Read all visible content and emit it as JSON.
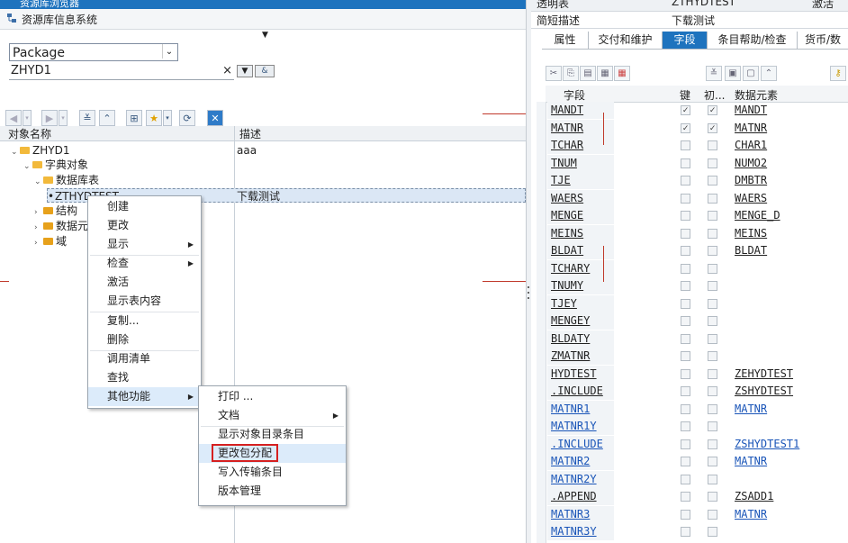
{
  "left": {
    "window_title": "资源库浏览器",
    "system_title": "资源库信息系统",
    "object_type": "Package",
    "object_name": "ZHYD1",
    "columns": {
      "name": "对象名称",
      "desc": "描述"
    },
    "tree": [
      {
        "label": "ZHYD1",
        "desc": "aaa"
      },
      {
        "label": "字典对象",
        "desc": ""
      },
      {
        "label": "数据库表",
        "desc": ""
      },
      {
        "label": "ZTHYDTEST",
        "desc": "下载测试"
      },
      {
        "label": "结构",
        "desc": ""
      },
      {
        "label": "数据元",
        "desc": ""
      },
      {
        "label": "域",
        "desc": ""
      }
    ],
    "context_menu": [
      "创建",
      "更改",
      "显示",
      "检查",
      "激活",
      "显示表内容",
      "复制...",
      "删除",
      "调用清单",
      "查找",
      "其他功能"
    ],
    "submenu": [
      "打印 ...",
      "文档",
      "显示对象目录条目",
      "更改包分配",
      "写入传输条目",
      "版本管理"
    ]
  },
  "right": {
    "header": [
      {
        "label": "透明表",
        "value": "ZTHYDTEST",
        "status": "激活"
      },
      {
        "label": "简短描述",
        "value": "下载测试",
        "status": ""
      }
    ],
    "tabs": [
      "属性",
      "交付和维护",
      "字段",
      "条目帮助/检查",
      "货币/数"
    ],
    "active_tab": "字段",
    "grid_headers": {
      "field": "字段",
      "key": "键",
      "init": "初...",
      "element": "数据元素"
    },
    "rows": [
      {
        "field": "MANDT",
        "key": true,
        "init": true,
        "elem": "MANDT",
        "blue": false
      },
      {
        "field": "MATNR",
        "key": true,
        "init": true,
        "elem": "MATNR",
        "blue": false
      },
      {
        "field": "TCHAR",
        "key": false,
        "init": false,
        "elem": "CHAR1",
        "blue": false
      },
      {
        "field": "TNUM",
        "key": false,
        "init": false,
        "elem": "NUMO2",
        "blue": false
      },
      {
        "field": "TJE",
        "key": false,
        "init": false,
        "elem": "DMBTR",
        "blue": false
      },
      {
        "field": "WAERS",
        "key": false,
        "init": false,
        "elem": "WAERS",
        "blue": false
      },
      {
        "field": "MENGE",
        "key": false,
        "init": false,
        "elem": "MENGE_D",
        "blue": false
      },
      {
        "field": "MEINS",
        "key": false,
        "init": false,
        "elem": "MEINS",
        "blue": false
      },
      {
        "field": "BLDAT",
        "key": false,
        "init": false,
        "elem": "BLDAT",
        "blue": false
      },
      {
        "field": "TCHARY",
        "key": false,
        "init": false,
        "elem": "",
        "blue": false
      },
      {
        "field": "TNUMY",
        "key": false,
        "init": false,
        "elem": "",
        "blue": false
      },
      {
        "field": "TJEY",
        "key": false,
        "init": false,
        "elem": "",
        "blue": false
      },
      {
        "field": "MENGEY",
        "key": false,
        "init": false,
        "elem": "",
        "blue": false
      },
      {
        "field": "BLDATY",
        "key": false,
        "init": false,
        "elem": "",
        "blue": false
      },
      {
        "field": "ZMATNR",
        "key": false,
        "init": false,
        "elem": "",
        "blue": false
      },
      {
        "field": "HYDTEST",
        "key": false,
        "init": false,
        "elem": "ZEHYDTEST",
        "blue": false
      },
      {
        "field": ".INCLUDE",
        "key": false,
        "init": false,
        "elem": "ZSHYDTEST",
        "blue": false
      },
      {
        "field": "MATNR1",
        "key": false,
        "init": false,
        "elem": "MATNR",
        "blue": true
      },
      {
        "field": "MATNR1Y",
        "key": false,
        "init": false,
        "elem": "",
        "blue": true
      },
      {
        "field": ".INCLUDE",
        "key": false,
        "init": false,
        "elem": "ZSHYDTEST1",
        "blue": true
      },
      {
        "field": "MATNR2",
        "key": false,
        "init": false,
        "elem": "MATNR",
        "blue": true
      },
      {
        "field": "MATNR2Y",
        "key": false,
        "init": false,
        "elem": "",
        "blue": true
      },
      {
        "field": ".APPEND",
        "key": false,
        "init": false,
        "elem": "ZSADD1",
        "blue": false
      },
      {
        "field": "MATNR3",
        "key": false,
        "init": false,
        "elem": "MATNR",
        "blue": true
      },
      {
        "field": "MATNR3Y",
        "key": false,
        "init": false,
        "elem": "",
        "blue": true
      }
    ]
  }
}
